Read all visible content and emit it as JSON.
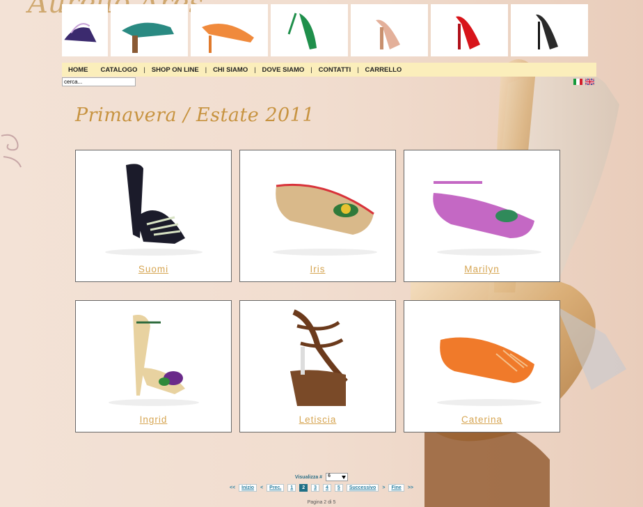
{
  "brand": {
    "logo_text": "Aurelio Ares"
  },
  "strip": {
    "items": [
      {
        "icon": "strappy-sandal-icon",
        "color": "#3b2a6e"
      },
      {
        "icon": "teal-heel-icon",
        "color": "#2a8a82"
      },
      {
        "icon": "orange-sandal-icon",
        "color": "#f08a3c"
      },
      {
        "icon": "green-heel-icon",
        "color": "#1f8f4b"
      },
      {
        "icon": "nude-platform-icon",
        "color": "#e3b09a"
      },
      {
        "icon": "red-heel-icon",
        "color": "#d8141a"
      },
      {
        "icon": "black-pump-icon",
        "color": "#2a2a2a"
      }
    ]
  },
  "nav": {
    "items": [
      {
        "label": "HOME"
      },
      {
        "label": "CATALOGO"
      },
      {
        "label": "SHOP ON LINE"
      },
      {
        "label": "CHI SIAMO"
      },
      {
        "label": "DOVE SIAMO"
      },
      {
        "label": "CONTATTI"
      },
      {
        "label": "CARRELLO"
      }
    ]
  },
  "search": {
    "value": "cerca..."
  },
  "flags": [
    {
      "name": "italian-flag-icon"
    },
    {
      "name": "uk-flag-icon"
    }
  ],
  "title": "Primavera / Estate 2011",
  "products": [
    {
      "name": "Suomi",
      "icon": "wedge-sandal-icon",
      "color": "#1b1b2a"
    },
    {
      "name": "Iris",
      "icon": "ballerina-flat-icon",
      "color": "#d9b98a"
    },
    {
      "name": "Marilyn",
      "icon": "ankle-strap-flat-icon",
      "color": "#c468c4"
    },
    {
      "name": "Ingrid",
      "icon": "stiletto-sandal-icon",
      "color": "#e8d2a0"
    },
    {
      "name": "Letiscia",
      "icon": "platform-sandal-icon",
      "color": "#6b3a1c"
    },
    {
      "name": "Caterina",
      "icon": "orange-flat-icon",
      "color": "#f07a2a"
    }
  ],
  "pager": {
    "per_page_label": "Visualizza #",
    "per_page_value": "6",
    "first": "Inizio",
    "prev": "Prec.",
    "pages": [
      "1",
      "2",
      "3",
      "4",
      "5"
    ],
    "current_page": "2",
    "next": "Successivo",
    "last": "Fine",
    "arrow_left_double": "<<",
    "arrow_left": "<",
    "arrow_right": ">",
    "arrow_right_double": ">>",
    "page_info": "Pagina 2 di 5"
  },
  "colors": {
    "nav_bg": "#fbeebb",
    "title": "#c79340",
    "product_link": "#d6a552",
    "pager_link": "#2a7fa1"
  }
}
